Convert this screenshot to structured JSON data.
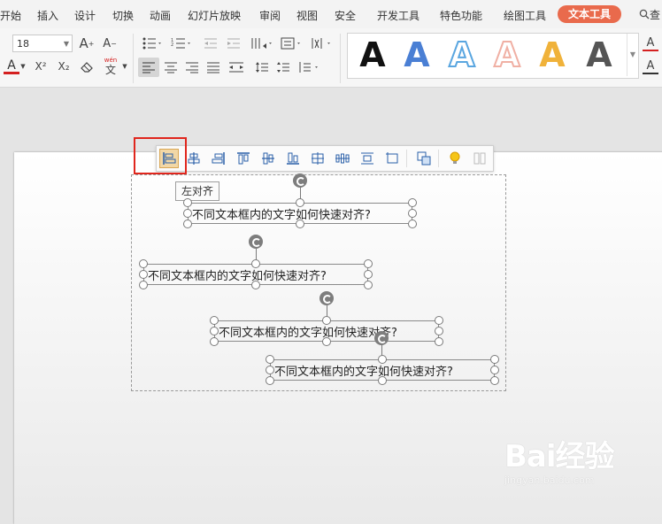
{
  "menu": {
    "items": [
      "开始",
      "插入",
      "设计",
      "切换",
      "动画",
      "幻灯片放映",
      "审阅",
      "视图",
      "安全",
      "开发工具",
      "特色功能",
      "绘图工具",
      "文本工具"
    ],
    "active": "文本工具",
    "search_partial": "查"
  },
  "ribbon": {
    "font_size": "18",
    "grow_font_icon_text": "A",
    "shrink_font_icon_text": "A",
    "font_color_icon_text": "A",
    "superscript_text": "X²",
    "subscript_text": "X₂",
    "phonetic_top": "wén",
    "phonetic_bottom": "文",
    "styles": [
      {
        "glyph": "A",
        "color": "#111111"
      },
      {
        "glyph": "A",
        "color": "#4a7fd4"
      },
      {
        "glyph": "A",
        "color": "#5aa6e0"
      },
      {
        "glyph": "A",
        "color": "#f0b0a4"
      },
      {
        "glyph": "A",
        "color": "#f0b23a"
      },
      {
        "glyph": "A",
        "color": "#555555"
      }
    ],
    "right_icon_1": "A",
    "right_icon_2": "A"
  },
  "tooltip": "左对齐",
  "textboxes": [
    "不同文本框内的文字如何快速对齐?",
    "不同文本框内的文字如何快速对齐?",
    "不同文本框内的文字如何快速对齐?",
    "不同文本框内的文字如何快速对齐?"
  ],
  "watermark": {
    "logo": "Bai经验",
    "url": "jingyan.baidu.com"
  },
  "colors": {
    "accent_tab": "#e96a4c",
    "highlight": "#e0261d",
    "selected_btn": "#f2d7a6"
  }
}
